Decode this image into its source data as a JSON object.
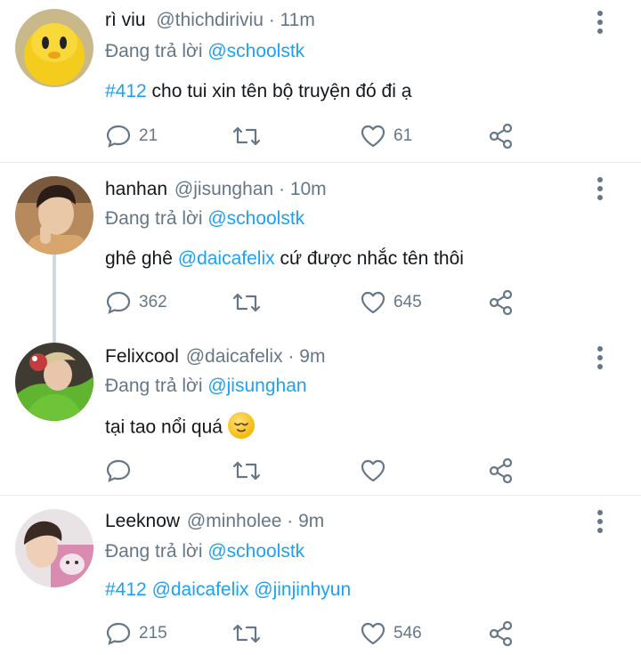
{
  "tweets": [
    {
      "name": "rì viu",
      "handle": "@thichdiriviu",
      "time": "· 11m",
      "reply_prefix": "Đang trả lời",
      "reply_to": "@schoolstk",
      "body_tag": "#412",
      "body_text": " cho tui xin tên bộ truyện đó đi ạ",
      "replies": "21",
      "likes": "61",
      "avatar": "yellow-cartoon-avatar"
    },
    {
      "name": "hanhan",
      "handle": "@jisunghan",
      "time": "· 10m",
      "reply_prefix": "Đang trả lời",
      "reply_to": "@schoolstk",
      "body_pre": "ghê ghê ",
      "body_mention": "@daicafelix",
      "body_post": " cứ được nhắc tên thôi",
      "replies": "362",
      "likes": "645",
      "avatar": "person-avatar"
    },
    {
      "name": "Felixcool",
      "handle": "@daicafelix",
      "time": "· 9m",
      "reply_prefix": "Đang trả lời",
      "reply_to": "@jisunghan",
      "body_text": "tại tao nổi quá",
      "emoji": "relieved-face-emoji",
      "avatar": "green-outfit-avatar"
    },
    {
      "name": "Leeknow",
      "handle": "@minholee",
      "time": "· 9m",
      "reply_prefix": "Đang trả lời",
      "reply_to": "@schoolstk",
      "body_tag": "#412",
      "body_mention1": "@daicafelix",
      "body_mention2": "@jinjinhyun",
      "replies": "215",
      "likes": "546",
      "avatar": "pink-photo-avatar"
    }
  ],
  "icons": [
    "reply-icon",
    "retweet-icon",
    "like-icon",
    "share-icon",
    "more-icon"
  ],
  "colors": {
    "link": "#1da1f2",
    "meta": "#657786",
    "text": "#14171a",
    "separator": "#e6ecf0"
  }
}
